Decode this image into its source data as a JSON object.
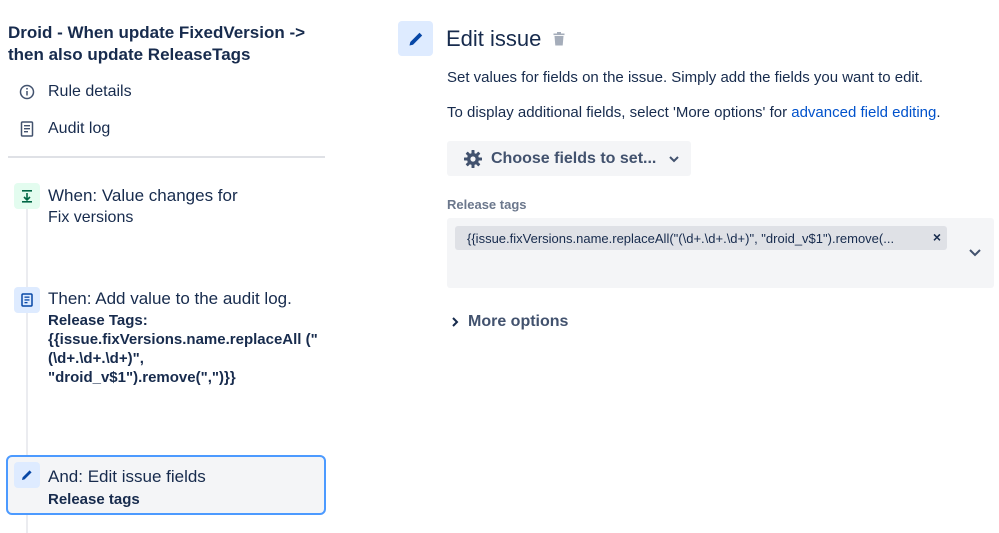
{
  "sidebar": {
    "rule_title": "Droid - When update FixedVersion -> then also update ReleaseTags",
    "nav": [
      {
        "label": "Rule details",
        "icon": "info-icon"
      },
      {
        "label": "Audit log",
        "icon": "document-icon"
      }
    ],
    "steps": [
      {
        "title": "When: Value changes for",
        "subtitle": "Fix versions",
        "icon": "trigger-icon"
      },
      {
        "title": "Then: Add value to the audit log.",
        "detail": "Release Tags: {{issue.fixVersions.name.replaceAll (\"(\\d+.\\d+.\\d+)\", \"droid_v$1\").remove(\",\")}}",
        "icon": "audit-log-icon"
      },
      {
        "title": "And: Edit issue fields",
        "detail": "Release tags",
        "icon": "pencil-icon",
        "selected": true
      }
    ]
  },
  "main": {
    "title": "Edit issue",
    "description1": "Set values for fields on the issue. Simply add the fields you want to edit.",
    "description2_prefix": "To display additional fields, select 'More options' for ",
    "description2_link": "advanced field editing",
    "description2_suffix": ".",
    "choose_fields_label": "Choose fields to set...",
    "field_label": "Release tags",
    "field_value": "{{issue.fixVersions.name.replaceAll(\"(\\d+.\\d+.\\d+)\", \"droid_v$1\").remove(...",
    "more_options_label": "More options"
  },
  "colors": {
    "text": "#172b4d",
    "link": "#0052cc",
    "selected_border": "#4c9aff",
    "trigger_bg": "#e3fcef",
    "action_bg": "#deebff"
  }
}
